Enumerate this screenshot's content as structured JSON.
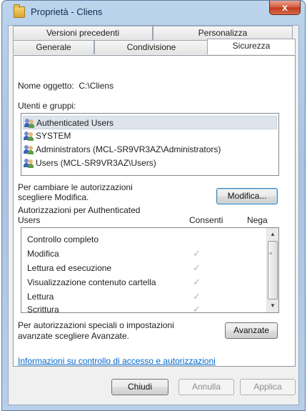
{
  "window": {
    "title": "Proprietà - Cliens",
    "close_glyph": "x"
  },
  "tabs": {
    "row_back": [
      "Versioni precedenti",
      "Personalizza"
    ],
    "row_front": [
      "Generale",
      "Condivisione",
      "Sicurezza"
    ]
  },
  "object": {
    "label": "Nome oggetto:",
    "value": "C:\\Cliens"
  },
  "groups": {
    "label": "Utenti e gruppi:",
    "items": [
      "Authenticated Users",
      "SYSTEM",
      "Administrators (MCL-SR9VR3AZ\\Administrators)",
      "Users (MCL-SR9VR3AZ\\Users)"
    ],
    "selected_index": 0
  },
  "change": {
    "text_line1": "Per cambiare le autorizzazioni",
    "text_line2": "scegliere Modifica.",
    "button": "Modifica..."
  },
  "permissions": {
    "title_line1": "Autorizzazioni per Authenticated",
    "title_line2": "Users",
    "col_allow": "Consenti",
    "col_deny": "Nega",
    "check_glyph": "✓",
    "rows": [
      {
        "name": "Controllo completo",
        "allow": false
      },
      {
        "name": "Modifica",
        "allow": true
      },
      {
        "name": "Lettura ed esecuzione",
        "allow": true
      },
      {
        "name": "Visualizzazione contenuto cartella",
        "allow": true
      },
      {
        "name": "Lettura",
        "allow": true
      },
      {
        "name": "Scrittura",
        "allow": true
      }
    ]
  },
  "advanced": {
    "text_line1": "Per autorizzazioni speciali o impostazioni",
    "text_line2": "avanzate scegliere Avanzate.",
    "button": "Avanzate"
  },
  "link": "Informazioni su controllo di accesso e autorizzazioni",
  "footer": {
    "ok": "Chiudi",
    "cancel": "Annulla",
    "apply": "Applica"
  }
}
